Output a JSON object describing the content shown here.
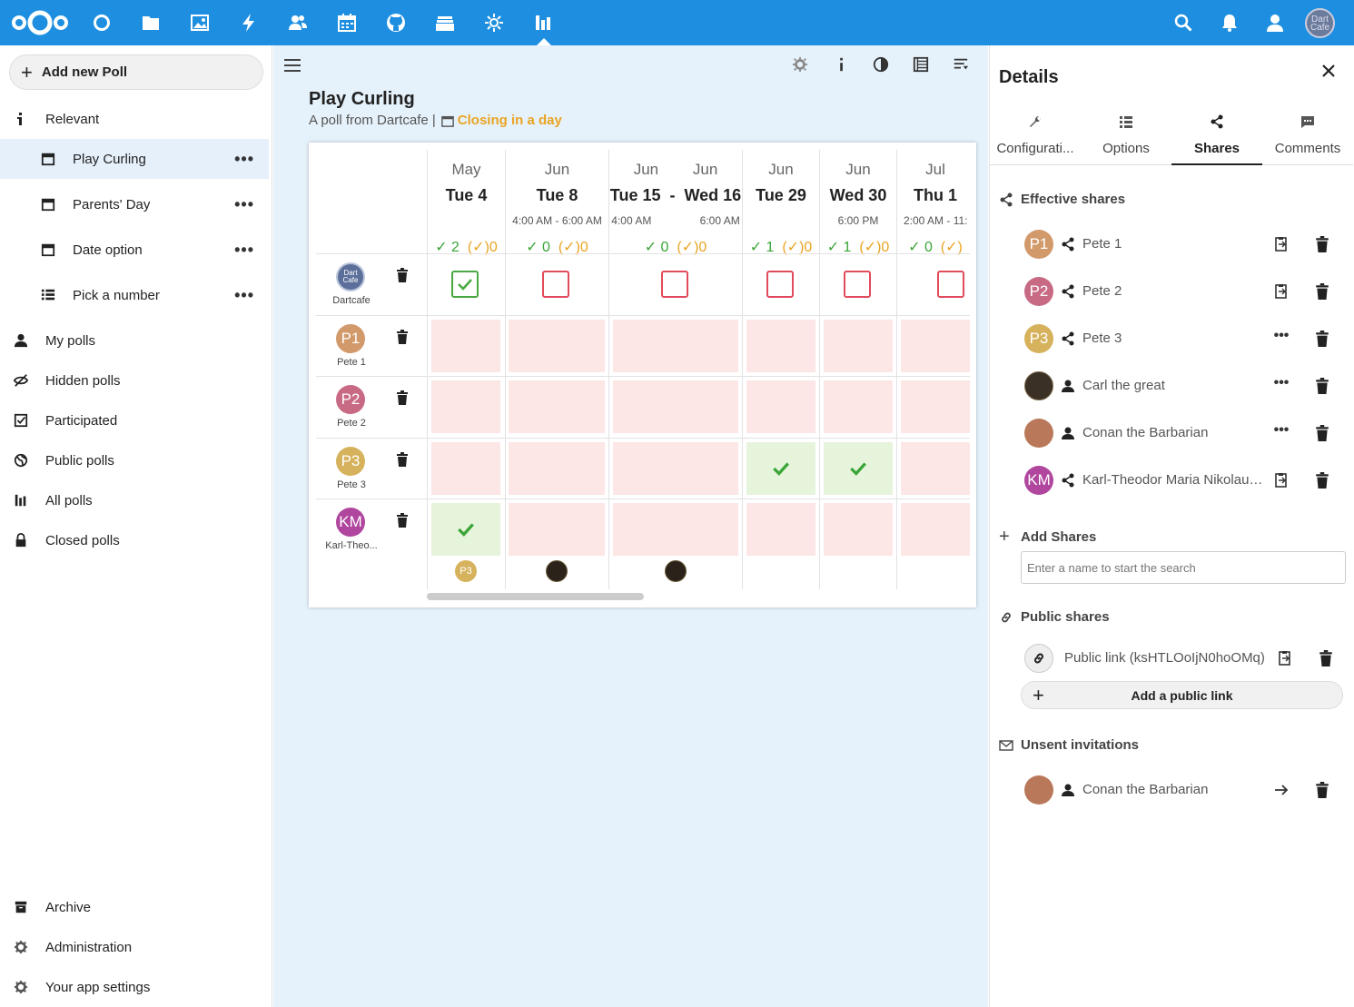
{
  "nav": {
    "add_poll": "Add new Poll",
    "items": {
      "relevant": "Relevant",
      "play_curling": "Play Curling",
      "parents_day": "Parents' Day",
      "date_option": "Date option",
      "pick_a_number": "Pick a number",
      "my_polls": "My polls",
      "hidden_polls": "Hidden polls",
      "participated": "Participated",
      "public_polls": "Public polls",
      "all_polls": "All polls",
      "closed_polls": "Closed polls",
      "archive": "Archive",
      "administration": "Administration",
      "app_settings": "Your app settings"
    },
    "more_icon_text": "•••"
  },
  "header": {
    "avatar_text": "Dart Cafe"
  },
  "poll": {
    "title": "Play Curling",
    "subtitle": "A poll from Dartcafe |",
    "closing": "Closing in a day",
    "options": [
      {
        "month": "May",
        "day": "Tue 4",
        "time": "",
        "yes": "2",
        "maybe": "0"
      },
      {
        "month": "Jun",
        "day": "Tue 8",
        "time": "4:00 AM  - 6:00 AM",
        "yes": "0",
        "maybe": "0"
      },
      {
        "month": "Jun        Jun",
        "day": "Tue 15  -  Wed 16",
        "time": "4:00 AM                6:00 AM",
        "yes": "0",
        "maybe": "0"
      },
      {
        "month": "Jun",
        "day": "Tue 29",
        "time": "",
        "yes": "1",
        "maybe": "0"
      },
      {
        "month": "Jun",
        "day": "Wed 30",
        "time": "6:00 PM",
        "yes": "1",
        "maybe": "0"
      },
      {
        "month": "Jul",
        "day": "Thu 1",
        "time": "2:00 AM  - 11:",
        "yes": "0",
        "maybe": ""
      }
    ],
    "participants": [
      {
        "name": "Dartcafe",
        "initials": "Dart Cafe"
      },
      {
        "name": "Pete 1",
        "initials": "P1"
      },
      {
        "name": "Pete 2",
        "initials": "P2"
      },
      {
        "name": "Pete 3",
        "initials": "P3"
      },
      {
        "name": "Karl-Theo...",
        "initials": "KM"
      }
    ],
    "footer_badge": "P3",
    "yes_mark": "✓",
    "maybe_mark": "(✓)"
  },
  "sidebar": {
    "title": "Details",
    "tabs": [
      "Configurati...",
      "Options",
      "Shares",
      "Comments"
    ],
    "effective_shares": "Effective shares",
    "shares": [
      {
        "initials": "P1",
        "name": "Pete 1",
        "color": "#d2996b"
      },
      {
        "initials": "P2",
        "name": "Pete 2",
        "color": "#c86a84"
      },
      {
        "initials": "P3",
        "name": "Pete 3",
        "color": "#d6b25c"
      },
      {
        "initials": "",
        "name": "Carl the great",
        "color": "#3a3026"
      },
      {
        "initials": "",
        "name": "Conan the Barbarian",
        "color": "#b9785a"
      },
      {
        "initials": "KM",
        "name": "Karl-Theodor Maria Nikolaus Johann Jacob Philipp Franz Joseph Sylvester",
        "color": "#b0469e"
      }
    ],
    "add_shares": "Add Shares",
    "search_placeholder": "Enter a name to start the search",
    "public_shares": "Public shares",
    "public_link": "Public link (ksHTLOoIjN0hoOMq)",
    "add_public_link": "Add a public link",
    "unsent": "Unsent invitations",
    "unsent_user": "Conan the Barbarian",
    "more_text": "•••"
  },
  "colors": {
    "header": "#1e8fe0",
    "accent_yes": "#3aa537",
    "accent_maybe": "#e9a423",
    "no_cell": "#fde6e6",
    "yes_cell": "#e7f4dc"
  }
}
